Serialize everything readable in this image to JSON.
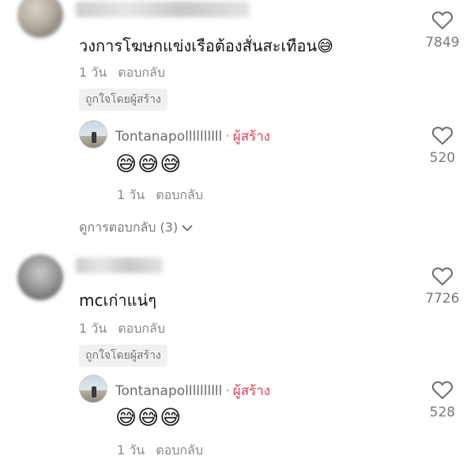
{
  "comments": [
    {
      "text": "วงการโฆษกแข่งเรือต้องสั่นสะเทือน😅",
      "time": "1 วัน",
      "reply_label": "ตอบกลับ",
      "liked_badge": "ถูกใจโดยผู้สร้าง",
      "likes": "7849",
      "reply": {
        "name": "Tontanapollllllllll",
        "separator": "·",
        "creator_tag": "ผู้สร้าง",
        "text": "😅😅😅",
        "time": "1 วัน",
        "reply_label": "ตอบกลับ",
        "likes": "520"
      },
      "view_replies": "ดูการตอบกลับ (3)"
    },
    {
      "text": "mcเก่าแน่ๆ",
      "time": "1 วัน",
      "reply_label": "ตอบกลับ",
      "liked_badge": "ถูกใจโดยผู้สร้าง",
      "likes": "7726",
      "reply": {
        "name": "Tontanapollllllllll",
        "separator": "·",
        "creator_tag": "ผู้สร้าง",
        "text": "😅😅😅",
        "time": "1 วัน",
        "reply_label": "ตอบกลับ",
        "likes": "528"
      }
    }
  ],
  "icons": {
    "like": "heart-outline-icon",
    "expand": "chevron-down-icon"
  },
  "colors": {
    "creator_tag": "#e53b5a",
    "meta_text": "#8a8a8a"
  }
}
